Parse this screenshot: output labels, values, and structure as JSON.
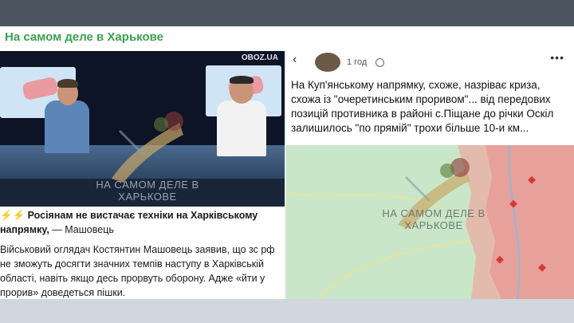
{
  "channel": {
    "title": "На самом деле в Харькове"
  },
  "left_post": {
    "tv_logo": "OBOZ.UA",
    "headline_emoji": "⚡⚡",
    "headline_bold": "Росіянам не вистачає техніки на Харківському напрямку,",
    "headline_rest": " — Машовець",
    "body": "Військовий оглядач Костянтин Машовець заявив, що зс рф не зможуть досягти значних темпів наступу в Харківській області, навіть якщо десь прорвуть оборону. Адже «йти у прорив» доведеться пішки.",
    "watermark_line1": "НА САМОМ ДЕЛЕ В",
    "watermark_line2": "ХАРЬКОВЕ"
  },
  "right_post": {
    "time": "1 год",
    "text": "На Куп'янському напрямку, схоже, назріває криза, схожа із \"очеретинським проривом\"... від передових позицій противника в районі с.Піщане до річки Оскіл залишилось \"по прямій\" трохи більше 10-и км...",
    "watermark_line1": "НА САМОМ ДЕЛЕ В",
    "watermark_line2": "ХАРЬКОВЕ"
  },
  "colors": {
    "channel_green": "#3aa150",
    "map_green": "#c9e6c8",
    "map_red": "#e8a09a",
    "topbar": "#4a5560"
  }
}
